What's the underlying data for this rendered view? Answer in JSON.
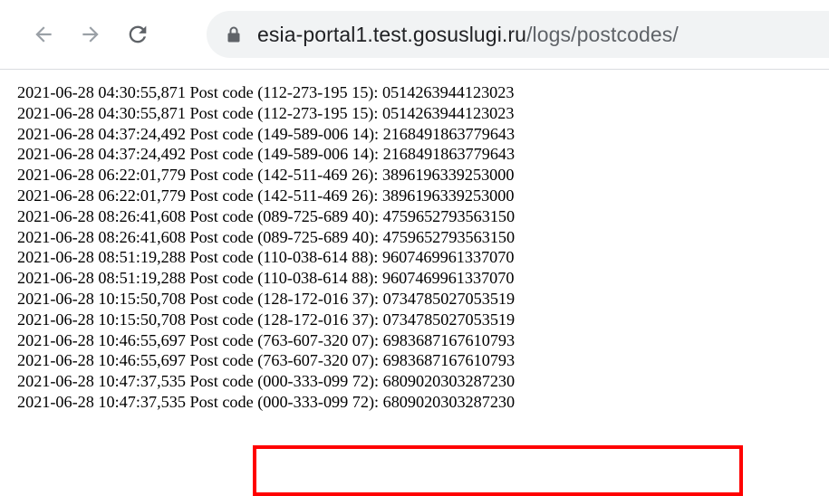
{
  "browser": {
    "url_host": "esia-portal1.test.gosuslugi.ru",
    "url_path": "/logs/postcodes/",
    "icons": {
      "back": "arrow-left-icon",
      "forward": "arrow-right-icon",
      "reload": "reload-icon",
      "security": "lock-icon"
    }
  },
  "log": {
    "lines": [
      "2021-06-28 04:30:55,871 Post code (112-273-195 15): 0514263944123023",
      "2021-06-28 04:30:55,871 Post code (112-273-195 15): 0514263944123023",
      "2021-06-28 04:37:24,492 Post code (149-589-006 14): 2168491863779643",
      "2021-06-28 04:37:24,492 Post code (149-589-006 14): 2168491863779643",
      "2021-06-28 06:22:01,779 Post code (142-511-469 26): 3896196339253000",
      "2021-06-28 06:22:01,779 Post code (142-511-469 26): 3896196339253000",
      "2021-06-28 08:26:41,608 Post code (089-725-689 40): 4759652793563150",
      "2021-06-28 08:26:41,608 Post code (089-725-689 40): 4759652793563150",
      "2021-06-28 08:51:19,288 Post code (110-038-614 88): 9607469961337070",
      "2021-06-28 08:51:19,288 Post code (110-038-614 88): 9607469961337070",
      "2021-06-28 10:15:50,708 Post code (128-172-016 37): 0734785027053519",
      "2021-06-28 10:15:50,708 Post code (128-172-016 37): 0734785027053519",
      "2021-06-28 10:46:55,697 Post code (763-607-320 07): 6983687167610793",
      "2021-06-28 10:46:55,697 Post code (763-607-320 07): 6983687167610793",
      "2021-06-28 10:47:37,535 Post code (000-333-099 72): 6809020303287230",
      "2021-06-28 10:47:37,535 Post code (000-333-099 72): 6809020303287230"
    ]
  },
  "annotation": {
    "highlight_color": "#ff0000"
  }
}
